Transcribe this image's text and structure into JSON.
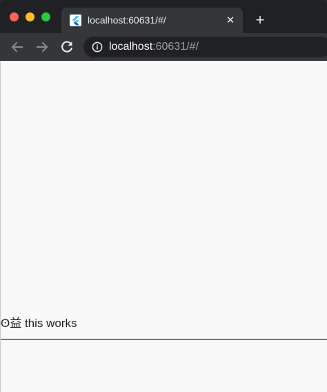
{
  "browser": {
    "tab": {
      "title": "localhost:60631/#/",
      "favicon": "flutter-icon",
      "close_glyph": "✕"
    },
    "new_tab_glyph": "+",
    "nav": {
      "back": "back-arrow-icon",
      "forward": "forward-arrow-icon",
      "reload": "reload-icon"
    },
    "address_bar": {
      "host": "localhost",
      "rest": ":60631/#/",
      "icon": "info-icon"
    }
  },
  "page": {
    "text_field": {
      "value": "ʘ益 this works",
      "underline_color": "#3a7fd5"
    }
  },
  "colors": {
    "page_background": "#f9f9f9",
    "tab_background": "#35363a",
    "tabstrip_background": "#202124",
    "traffic_red": "#fe5f57",
    "traffic_yellow": "#febc2e",
    "traffic_green": "#28c840"
  }
}
